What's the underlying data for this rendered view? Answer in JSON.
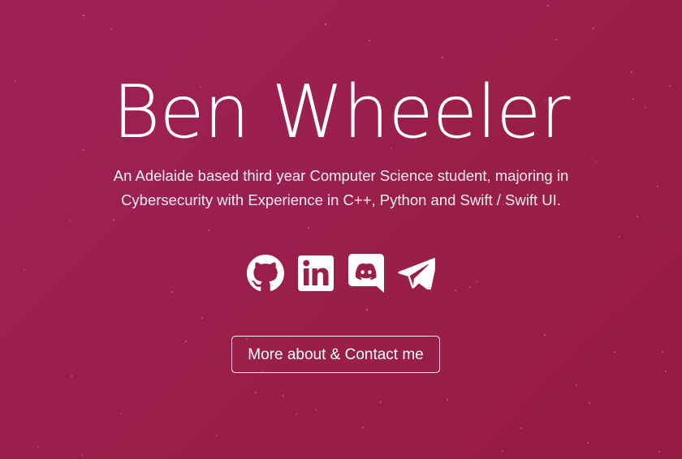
{
  "hero": {
    "name": "Ben Wheeler",
    "tagline_line1": "An Adelaide based third year Computer Science student, majoring in",
    "tagline_line2": "Cybersecurity with Experience in C++, Python and Swift / Swift UI."
  },
  "socials": [
    {
      "icon": "github-icon"
    },
    {
      "icon": "linkedin-icon"
    },
    {
      "icon": "discord-icon"
    },
    {
      "icon": "telegram-icon"
    }
  ],
  "cta": {
    "label": "More about & Contact me"
  },
  "colors": {
    "background": "#9a1f4b",
    "text": "#ffffff"
  }
}
